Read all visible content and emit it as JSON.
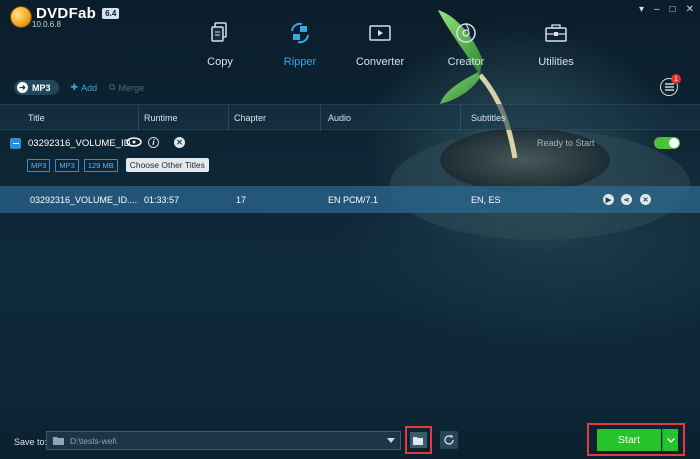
{
  "app": {
    "name": "DVDFab",
    "version_badge": "6.4",
    "build": "10.0.6.8"
  },
  "window_controls": [
    "▾",
    "–",
    "□",
    "✕"
  ],
  "nav": [
    {
      "label": "Copy",
      "icon": "copy-icon",
      "active": false
    },
    {
      "label": "Ripper",
      "icon": "ripper-icon",
      "active": true
    },
    {
      "label": "Converter",
      "icon": "converter-icon",
      "active": false
    },
    {
      "label": "Creator",
      "icon": "creator-icon",
      "active": false
    },
    {
      "label": "Utilities",
      "icon": "utilities-icon",
      "active": false
    }
  ],
  "menu": {
    "badge": "1"
  },
  "toolbar": {
    "profile": "MP3",
    "add": "Add",
    "merge": "Merge"
  },
  "table": {
    "columns": [
      "Title",
      "Runtime",
      "Chapter",
      "Audio",
      "Subtitles"
    ]
  },
  "title_group": {
    "volume": "03292316_VOLUME_ID",
    "status": "Ready to Start",
    "tags": [
      "MP3",
      "MP3",
      "129 MB"
    ],
    "choose_button": "Choose Other Titles",
    "enabled": true
  },
  "track": {
    "title": "03292316_VOLUME_ID....",
    "runtime": "01:33:57",
    "chapter": "17",
    "audio": "EN  PCM/7.1",
    "subtitles": "EN, ES"
  },
  "footer": {
    "save_label": "Save to:",
    "save_path": "D:\\tests-wel\\",
    "start_label": "Start"
  },
  "colors": {
    "accent": "#36a8e4",
    "start": "#27c32c",
    "highlight_box": "#e23b3b"
  }
}
